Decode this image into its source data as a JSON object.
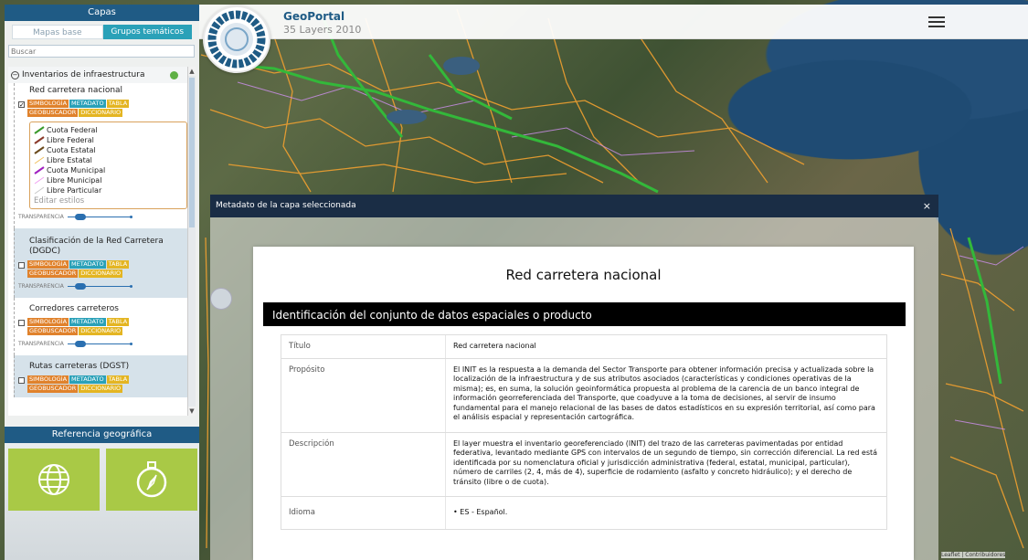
{
  "header": {
    "app_title": "GeoPortal",
    "app_subtitle": "35 Layers 2010",
    "menu_icon": "hamburger-icon"
  },
  "sidebar": {
    "panel_title": "Capas",
    "tabs": [
      {
        "label": "Mapas base",
        "active": false
      },
      {
        "label": "Grupos temáticos",
        "active": true
      }
    ],
    "search_placeholder": "Buscar",
    "group": {
      "label": "Inventarios de infraestructura",
      "status_color": "#5fb045"
    },
    "layers": [
      {
        "name": "Red carretera nacional",
        "checked": true
      },
      {
        "name": "Clasificación de la Red Carretera (DGDC)",
        "checked": false
      },
      {
        "name": "Corredores carreteros",
        "checked": false
      },
      {
        "name": "Rutas carreteras (DGST)",
        "checked": false
      }
    ],
    "layer_buttons": {
      "symbology": "SIMBOLOGÍA",
      "metadata": "METADATO",
      "table": "TABLA",
      "geosearch": "GEOBUSCADOR",
      "dictionary": "DICCIONARIO"
    },
    "legend": [
      {
        "label": "Cuota Federal",
        "color": "#3a9a2c"
      },
      {
        "label": "Libre Federal",
        "color": "#8b3a2a"
      },
      {
        "label": "Cuota Estatal",
        "color": "#6b4a1c"
      },
      {
        "label": "Libre Estatal",
        "color": "#f0c060"
      },
      {
        "label": "Cuota Municipal",
        "color": "#a020c0"
      },
      {
        "label": "Libre Municipal",
        "color": "#f0a0f0"
      },
      {
        "label": "Libre Particular",
        "color": "#c8c8c8"
      }
    ],
    "edit_styles": "Editar estilos",
    "transparency_label": "TRANSPARENCIA",
    "reference_title": "Referencia geográfica",
    "reference_buttons": [
      {
        "icon": "globe-icon"
      },
      {
        "icon": "compass-icon"
      }
    ]
  },
  "modal": {
    "header_title": "Metadato de la capa seleccionada",
    "close_label": "×",
    "doc_title": "Red carretera nacional",
    "section_title": "Identificación del conjunto de datos espaciales o producto",
    "rows": [
      {
        "key": "Título",
        "value": "Red carretera nacional"
      },
      {
        "key": "Propósito",
        "value": "El INIT es la respuesta a la demanda del Sector Transporte para obtener información precisa y actualizada sobre la localización de la infraestructura y de sus atributos asociados (características y condiciones operativas de la misma); es, en suma, la solución geoinformática propuesta al problema de la carencia de un banco integral de información georreferenciada del Transporte, que coadyuve a la toma de decisiones, al servir de insumo fundamental para el manejo relacional de las bases de datos estadísticos en su expresión territorial, así como para el análisis espacial y representación cartográfica."
      },
      {
        "key": "Descripción",
        "value": "El layer muestra el inventario georeferenciado (INIT) del trazo de las carreteras pavimentadas por entidad federativa, levantado mediante GPS con intervalos de un segundo de tiempo, sin corrección diferencial. La red está identificada por su nomenclatura oficial y jurisdicción administrativa (federal, estatal, municipal, particular), número de carriles (2, 4, más de 4), superficie de rodamiento (asfalto y concreto hidráulico); y el derecho de tránsito (libre o de cuota)."
      },
      {
        "key": "Idioma",
        "value": "• ES - Español."
      }
    ]
  },
  "map": {
    "attribution": "Leaflet | Contribuidores"
  }
}
